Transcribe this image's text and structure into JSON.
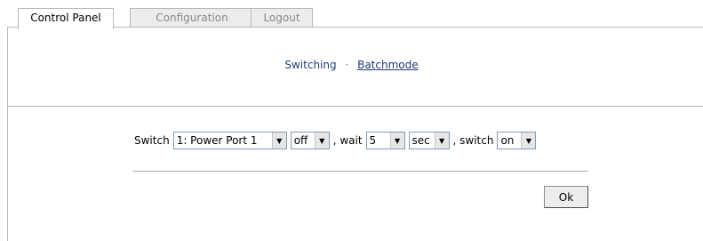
{
  "tabs": [
    {
      "label": "Control Panel",
      "active": true
    },
    {
      "label": "Configuration",
      "active": false
    },
    {
      "label": "Logout",
      "active": false
    }
  ],
  "subnav": {
    "switching": "Switching",
    "separator": "·",
    "batchmode": "Batchmode"
  },
  "batch": {
    "switch_label": "Switch",
    "port_selected": "1: Power Port 1",
    "state_selected": "off",
    "wait_label": ", wait",
    "wait_selected": "5",
    "unit_selected": "sec",
    "switch2_label": ", switch",
    "state2_selected": "on"
  },
  "ok_label": "Ok",
  "icons": {
    "dropdown": "chevron-down-icon"
  },
  "colors": {
    "link": "#223a76",
    "border": "#b8b8b8"
  }
}
